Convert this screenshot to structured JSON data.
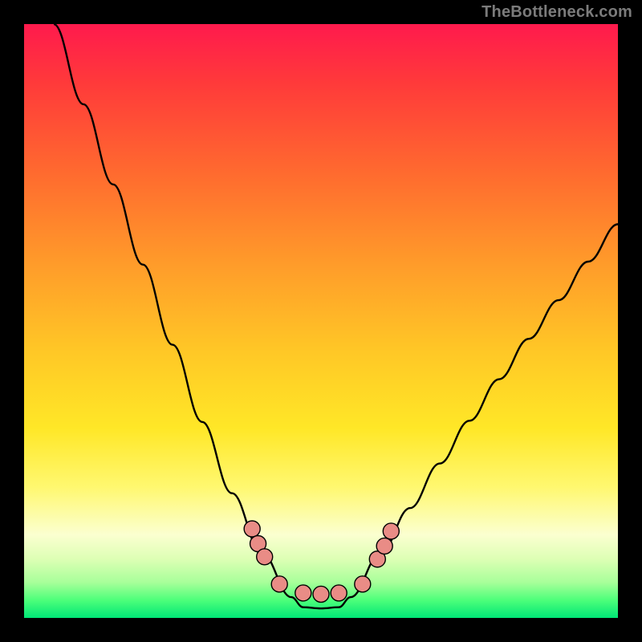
{
  "watermark": "TheBottleneck.com",
  "chart_data": {
    "type": "line",
    "title": "",
    "xlabel": "",
    "ylabel": "",
    "xlim": [
      0,
      100
    ],
    "ylim": [
      0,
      100
    ],
    "series": [
      {
        "name": "bottleneck-curve",
        "x": [
          5,
          10,
          15,
          20,
          25,
          30,
          35,
          40,
          45,
          47,
          50,
          53,
          55,
          60,
          65,
          70,
          75,
          80,
          85,
          90,
          95,
          100
        ],
        "values": [
          100,
          86.5,
          73.0,
          59.5,
          46.0,
          33.0,
          21.0,
          11.0,
          3.5,
          1.8,
          1.6,
          1.8,
          3.5,
          10.8,
          18.5,
          26.0,
          33.2,
          40.2,
          47.0,
          53.5,
          60.0,
          66.3
        ]
      }
    ],
    "markers": {
      "name": "highlight-dots",
      "x": [
        38.4,
        39.4,
        40.5,
        43.0,
        47.0,
        50.0,
        53.0,
        57.0,
        59.5,
        60.7,
        61.8
      ],
      "values": [
        15.0,
        12.5,
        10.3,
        5.7,
        4.2,
        4.0,
        4.2,
        5.7,
        9.9,
        12.1,
        14.6
      ]
    },
    "colors": {
      "curve": "#000000",
      "marker_fill": "#e98c86",
      "marker_stroke": "#000000",
      "gradient_top": "#ff1a4d",
      "gradient_bottom": "#00e676",
      "frame": "#000000"
    }
  }
}
